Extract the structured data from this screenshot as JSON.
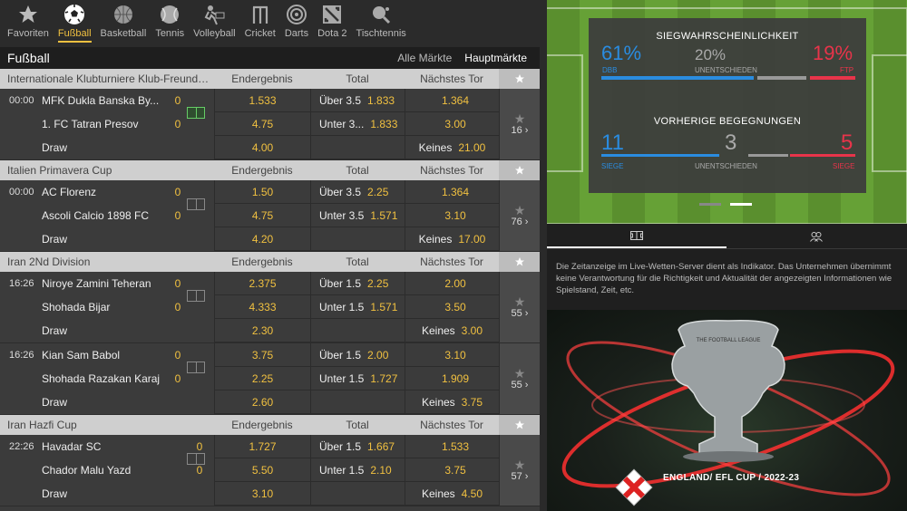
{
  "sports": [
    {
      "label": "Favoriten",
      "icon": "star-icon"
    },
    {
      "label": "Fußball",
      "icon": "soccer-ball-icon",
      "active": true
    },
    {
      "label": "Basketball",
      "icon": "basketball-icon"
    },
    {
      "label": "Tennis",
      "icon": "tennis-ball-icon"
    },
    {
      "label": "Volleyball",
      "icon": "volleyball-icon"
    },
    {
      "label": "Cricket",
      "icon": "cricket-icon"
    },
    {
      "label": "Darts",
      "icon": "darts-icon"
    },
    {
      "label": "Dota 2",
      "icon": "dota2-icon"
    },
    {
      "label": "Tischtennis",
      "icon": "table-tennis-icon"
    }
  ],
  "header": {
    "title": "Fußball",
    "all_markets": "Alle Märkte",
    "main_markets": "Hauptmärkte"
  },
  "col_labels": {
    "c1": "Endergebnis",
    "c2": "Total",
    "c3": "Nächstes Tor"
  },
  "groups": [
    {
      "name": "Internationale Klubturniere Klub-Freundsch...",
      "matches": [
        {
          "time": "00:00",
          "home": "MFK Dukla Banska By...",
          "away": "1. FC Tatran Presov",
          "draw": "Draw",
          "hs": "0",
          "as": "0",
          "live": true,
          "odds1": [
            "1.533",
            "4.75",
            "4.00"
          ],
          "total": [
            {
              "l": "Über 3.5",
              "v": "1.833"
            },
            {
              "l": "Unter 3...",
              "v": "1.833"
            },
            {
              "l": "",
              "v": ""
            }
          ],
          "next": [
            {
              "l": "",
              "v": "1.364"
            },
            {
              "l": "",
              "v": "3.00"
            },
            {
              "l": "Keines",
              "v": "21.00"
            }
          ],
          "more": "16"
        }
      ]
    },
    {
      "name": "Italien Primavera Cup",
      "matches": [
        {
          "time": "00:00",
          "home": "AC Florenz",
          "away": "Ascoli Calcio 1898 FC",
          "draw": "Draw",
          "hs": "0",
          "as": "0",
          "live": false,
          "odds1": [
            "1.50",
            "4.75",
            "4.20"
          ],
          "total": [
            {
              "l": "Über 3.5",
              "v": "2.25"
            },
            {
              "l": "Unter 3.5",
              "v": "1.571"
            },
            {
              "l": "",
              "v": ""
            }
          ],
          "next": [
            {
              "l": "",
              "v": "1.364"
            },
            {
              "l": "",
              "v": "3.10"
            },
            {
              "l": "Keines",
              "v": "17.00"
            }
          ],
          "more": "76"
        }
      ]
    },
    {
      "name": "Iran 2Nd Division",
      "matches": [
        {
          "time": "16:26",
          "home": "Niroye Zamini Teheran",
          "away": "Shohada Bijar",
          "draw": "Draw",
          "hs": "0",
          "as": "0",
          "live": false,
          "odds1": [
            "2.375",
            "4.333",
            "2.30"
          ],
          "total": [
            {
              "l": "Über 1.5",
              "v": "2.25"
            },
            {
              "l": "Unter 1.5",
              "v": "1.571"
            },
            {
              "l": "",
              "v": ""
            }
          ],
          "next": [
            {
              "l": "",
              "v": "2.00"
            },
            {
              "l": "",
              "v": "3.50"
            },
            {
              "l": "Keines",
              "v": "3.00"
            }
          ],
          "more": "55"
        },
        {
          "time": "16:26",
          "home": "Kian Sam Babol",
          "away": "Shohada Razakan Karaj",
          "draw": "Draw",
          "hs": "0",
          "as": "0",
          "live": false,
          "odds1": [
            "3.75",
            "2.25",
            "2.60"
          ],
          "total": [
            {
              "l": "Über 1.5",
              "v": "2.00"
            },
            {
              "l": "Unter 1.5",
              "v": "1.727"
            },
            {
              "l": "",
              "v": ""
            }
          ],
          "next": [
            {
              "l": "",
              "v": "3.10"
            },
            {
              "l": "",
              "v": "1.909"
            },
            {
              "l": "Keines",
              "v": "3.75"
            }
          ],
          "more": "55"
        }
      ]
    },
    {
      "name": "Iran Hazfi Cup",
      "matches": [
        {
          "time": "22:26",
          "home": "Havadar SC",
          "away": "Chador Malu Yazd",
          "draw": "Draw",
          "hs": "0",
          "as": "0",
          "live": false,
          "scoreShift": true,
          "odds1": [
            "1.727",
            "5.50",
            "3.10"
          ],
          "total": [
            {
              "l": "Über 1.5",
              "v": "1.667"
            },
            {
              "l": "Unter 1.5",
              "v": "2.10"
            },
            {
              "l": "",
              "v": ""
            }
          ],
          "next": [
            {
              "l": "",
              "v": "1.533"
            },
            {
              "l": "",
              "v": "3.75"
            },
            {
              "l": "Keines",
              "v": "4.50"
            }
          ],
          "more": "57"
        }
      ]
    }
  ],
  "stats": {
    "win_title": "SIEGWAHRSCHEINLICHKEIT",
    "home_pct": "61",
    "home_lbl": "DBB",
    "draw_pct": "20",
    "draw_lbl": "UNENTSCHIEDEN",
    "away_pct": "19",
    "away_lbl": "FTP",
    "pct_sign": "%",
    "h2h_title": "VORHERIGE BEGEGNUNGEN",
    "h2h_home": "11",
    "h2h_home_lbl": "SIEGE",
    "h2h_draw": "3",
    "h2h_draw_lbl": "UNENTSCHIEDEN",
    "h2h_away": "5",
    "h2h_away_lbl": "SIEGE"
  },
  "colors": {
    "accent": "#f0c040",
    "home": "#2a8ce0",
    "away": "#e8344a",
    "draw": "#999999"
  },
  "disclaimer": "Die Zeitanzeige im Live-Wetten-Server  dient als Indikator. Das Unternehmen übernimmt keine Verantwortung für die  Richtigkeit und Aktualität der angezeigten Informationen wie Spielstand, Zeit, etc.",
  "banner": {
    "text": "ENGLAND/ EFL CUP / 2022-23",
    "trophy_label": "THE FOOTBALL LEAGUE"
  }
}
